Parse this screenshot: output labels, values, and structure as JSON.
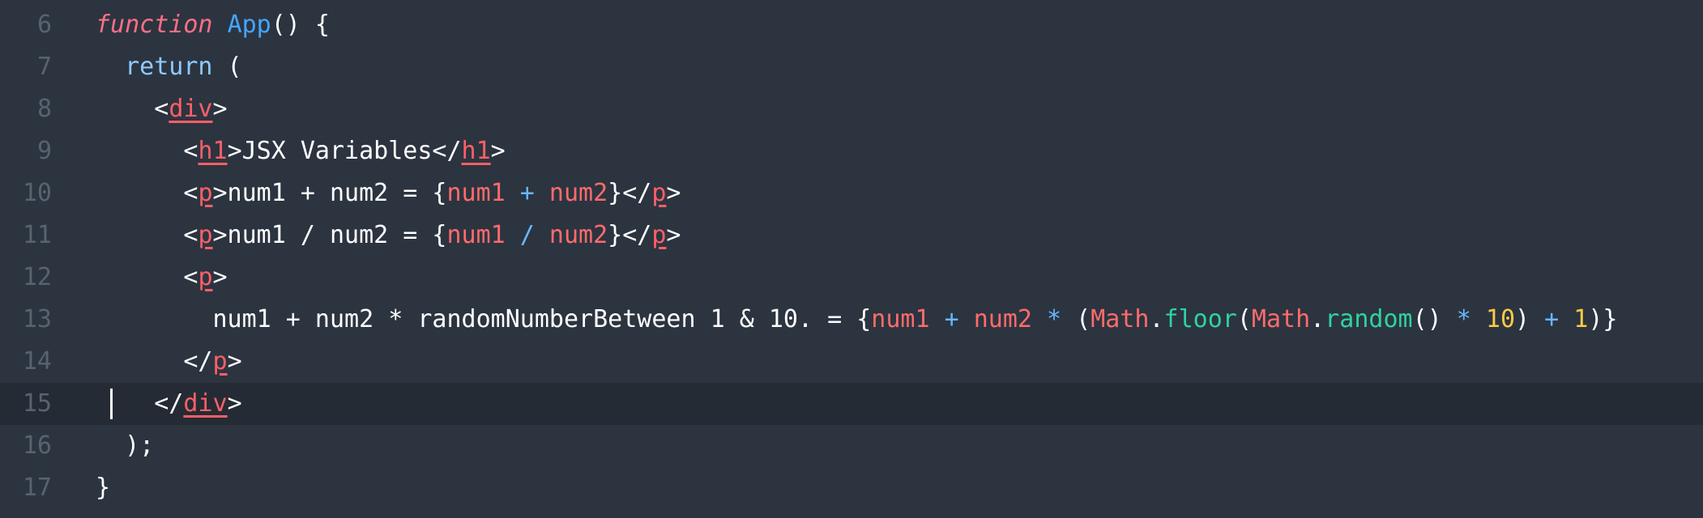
{
  "editor": {
    "current_line": "15",
    "colors": {
      "background": "#2c3440",
      "current_line_background": "#252b34",
      "gutter": "#596270",
      "keyword_function": "#ff6f86",
      "function_name": "#44a6ff",
      "keyword": "#8fc9ff",
      "tag": "#ff5f67",
      "expression": "#ff6b6b",
      "operator": "#6ab6ff",
      "method": "#2fd3a0",
      "number": "#ffca43"
    },
    "lines": [
      {
        "number": "6",
        "tokens": [
          {
            "text": "function",
            "kind": "kw-fn"
          },
          {
            "text": " ",
            "kind": "plain"
          },
          {
            "text": "App",
            "kind": "fn"
          },
          {
            "text": "() {",
            "kind": "plain"
          }
        ]
      },
      {
        "number": "7",
        "tokens": [
          {
            "text": "  ",
            "kind": "plain"
          },
          {
            "text": "return",
            "kind": "kw"
          },
          {
            "text": " (",
            "kind": "plain"
          }
        ]
      },
      {
        "number": "8",
        "tokens": [
          {
            "text": "    <",
            "kind": "plain"
          },
          {
            "text": "div",
            "kind": "tag"
          },
          {
            "text": ">",
            "kind": "plain"
          }
        ]
      },
      {
        "number": "9",
        "tokens": [
          {
            "text": "      <",
            "kind": "plain"
          },
          {
            "text": "h1",
            "kind": "tag"
          },
          {
            "text": ">JSX Variables</",
            "kind": "plain"
          },
          {
            "text": "h1",
            "kind": "tag"
          },
          {
            "text": ">",
            "kind": "plain"
          }
        ]
      },
      {
        "number": "10",
        "tokens": [
          {
            "text": "      <",
            "kind": "plain"
          },
          {
            "text": "p",
            "kind": "tag"
          },
          {
            "text": ">num1 + num2 = {",
            "kind": "plain"
          },
          {
            "text": "num1",
            "kind": "expr"
          },
          {
            "text": " + ",
            "kind": "op"
          },
          {
            "text": "num2",
            "kind": "expr"
          },
          {
            "text": "}</",
            "kind": "plain"
          },
          {
            "text": "p",
            "kind": "tag"
          },
          {
            "text": ">",
            "kind": "plain"
          }
        ]
      },
      {
        "number": "11",
        "tokens": [
          {
            "text": "      <",
            "kind": "plain"
          },
          {
            "text": "p",
            "kind": "tag"
          },
          {
            "text": ">num1 / num2 = {",
            "kind": "plain"
          },
          {
            "text": "num1",
            "kind": "expr"
          },
          {
            "text": " / ",
            "kind": "op"
          },
          {
            "text": "num2",
            "kind": "expr"
          },
          {
            "text": "}</",
            "kind": "plain"
          },
          {
            "text": "p",
            "kind": "tag"
          },
          {
            "text": ">",
            "kind": "plain"
          }
        ]
      },
      {
        "number": "12",
        "tokens": [
          {
            "text": "      <",
            "kind": "plain"
          },
          {
            "text": "p",
            "kind": "tag"
          },
          {
            "text": ">",
            "kind": "plain"
          }
        ]
      },
      {
        "number": "13",
        "tokens": [
          {
            "text": "        num1 + num2 * randomNumberBetween 1 & 10. = {",
            "kind": "plain"
          },
          {
            "text": "num1",
            "kind": "expr"
          },
          {
            "text": " + ",
            "kind": "op"
          },
          {
            "text": "num2",
            "kind": "expr"
          },
          {
            "text": " * ",
            "kind": "op"
          },
          {
            "text": "(",
            "kind": "plain"
          },
          {
            "text": "Math",
            "kind": "expr"
          },
          {
            "text": ".",
            "kind": "plain"
          },
          {
            "text": "floor",
            "kind": "method"
          },
          {
            "text": "(",
            "kind": "plain"
          },
          {
            "text": "Math",
            "kind": "expr"
          },
          {
            "text": ".",
            "kind": "plain"
          },
          {
            "text": "random",
            "kind": "method"
          },
          {
            "text": "()",
            "kind": "plain"
          },
          {
            "text": " * ",
            "kind": "op"
          },
          {
            "text": "10",
            "kind": "num"
          },
          {
            "text": ")",
            "kind": "plain"
          },
          {
            "text": " + ",
            "kind": "op"
          },
          {
            "text": "1",
            "kind": "num"
          },
          {
            "text": ")}",
            "kind": "plain"
          }
        ]
      },
      {
        "number": "14",
        "tokens": [
          {
            "text": "      </",
            "kind": "plain"
          },
          {
            "text": "p",
            "kind": "tag"
          },
          {
            "text": ">",
            "kind": "plain"
          }
        ]
      },
      {
        "number": "15",
        "tokens": [
          {
            "text": "    </",
            "kind": "plain"
          },
          {
            "text": "div",
            "kind": "tag"
          },
          {
            "text": ">",
            "kind": "plain"
          }
        ]
      },
      {
        "number": "16",
        "tokens": [
          {
            "text": "  );",
            "kind": "plain"
          }
        ]
      },
      {
        "number": "17",
        "tokens": [
          {
            "text": "}",
            "kind": "plain"
          }
        ]
      }
    ]
  }
}
